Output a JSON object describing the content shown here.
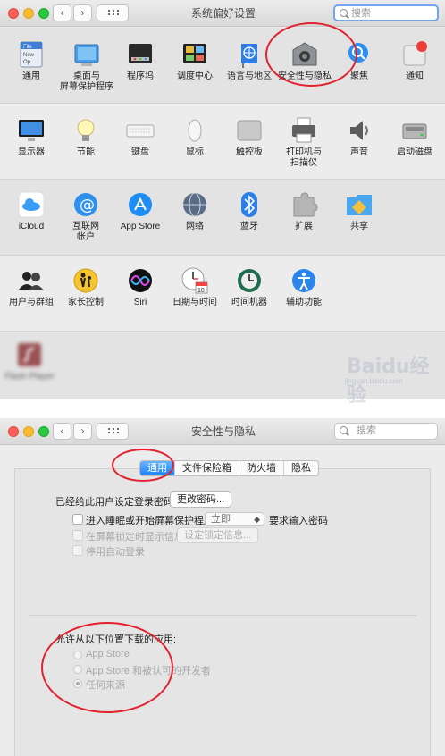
{
  "win1": {
    "title": "系统偏好设置",
    "search_placeholder": "搜索",
    "rows": [
      [
        {
          "icon": "general-icon",
          "label": "通用",
          "file_badge": "File\nNew\nOp"
        },
        {
          "icon": "desktop-screensaver-icon",
          "label": "桌面与\n屏幕保护程序"
        },
        {
          "icon": "dock-icon",
          "label": "程序坞"
        },
        {
          "icon": "mission-control-icon",
          "label": "调度中心"
        },
        {
          "icon": "language-region-icon",
          "label": "语言与地区"
        },
        {
          "icon": "security-privacy-icon",
          "label": "安全性与隐私"
        },
        {
          "icon": "spotlight-icon",
          "label": "聚焦"
        },
        {
          "icon": "notifications-icon",
          "label": "通知"
        }
      ],
      [
        {
          "icon": "displays-icon",
          "label": "显示器"
        },
        {
          "icon": "energy-saver-icon",
          "label": "节能"
        },
        {
          "icon": "keyboard-icon",
          "label": "键盘"
        },
        {
          "icon": "mouse-icon",
          "label": "鼠标"
        },
        {
          "icon": "trackpad-icon",
          "label": "触控板"
        },
        {
          "icon": "printers-scanners-icon",
          "label": "打印机与\n扫描仪"
        },
        {
          "icon": "sound-icon",
          "label": "声音"
        },
        {
          "icon": "startup-disk-icon",
          "label": "启动磁盘"
        }
      ],
      [
        {
          "icon": "icloud-icon",
          "label": "iCloud"
        },
        {
          "icon": "internet-accounts-icon",
          "label": "互联网\n帐户"
        },
        {
          "icon": "app-store-icon",
          "label": "App Store"
        },
        {
          "icon": "network-icon",
          "label": "网络"
        },
        {
          "icon": "bluetooth-icon",
          "label": "蓝牙"
        },
        {
          "icon": "extensions-icon",
          "label": "扩展"
        },
        {
          "icon": "sharing-icon",
          "label": "共享"
        }
      ],
      [
        {
          "icon": "users-groups-icon",
          "label": "用户与群组"
        },
        {
          "icon": "parental-controls-icon",
          "label": "家长控制"
        },
        {
          "icon": "siri-icon",
          "label": "Siri"
        },
        {
          "icon": "date-time-icon",
          "label": "日期与时间",
          "calendar_day": "18"
        },
        {
          "icon": "time-machine-icon",
          "label": "时间机器"
        },
        {
          "icon": "accessibility-icon",
          "label": "辅助功能"
        }
      ],
      [
        {
          "icon": "flash-player-icon",
          "label": "Flash Player"
        }
      ]
    ],
    "watermark": "Baidu经验",
    "watermark_url": "jingyan.baidu.com"
  },
  "win2": {
    "title": "安全性与隐私",
    "search_placeholder": "搜索",
    "tabs": [
      "通用",
      "文件保险箱",
      "防火墙",
      "隐私"
    ],
    "active_tab": "通用",
    "password_set_text": "已经给此用户设定登录密码",
    "change_password_button": "更改密码...",
    "require_password_label": "进入睡眠或开始屏幕保护程序",
    "require_password_delay": "立即",
    "require_password_suffix": "要求输入密码",
    "lock_message_label": "在屏幕锁定时显示信息",
    "lock_message_button": "设定锁定信息...",
    "disable_autologin_label": "停用自动登录",
    "allow_apps_heading": "允许从以下位置下载的应用:",
    "sources": [
      "App Store",
      "App Store 和被认可的开发者",
      "任何来源"
    ],
    "selected_source": "任何来源"
  },
  "colors": {
    "annotation": "#e0232e",
    "accent": "#1a82fb"
  }
}
